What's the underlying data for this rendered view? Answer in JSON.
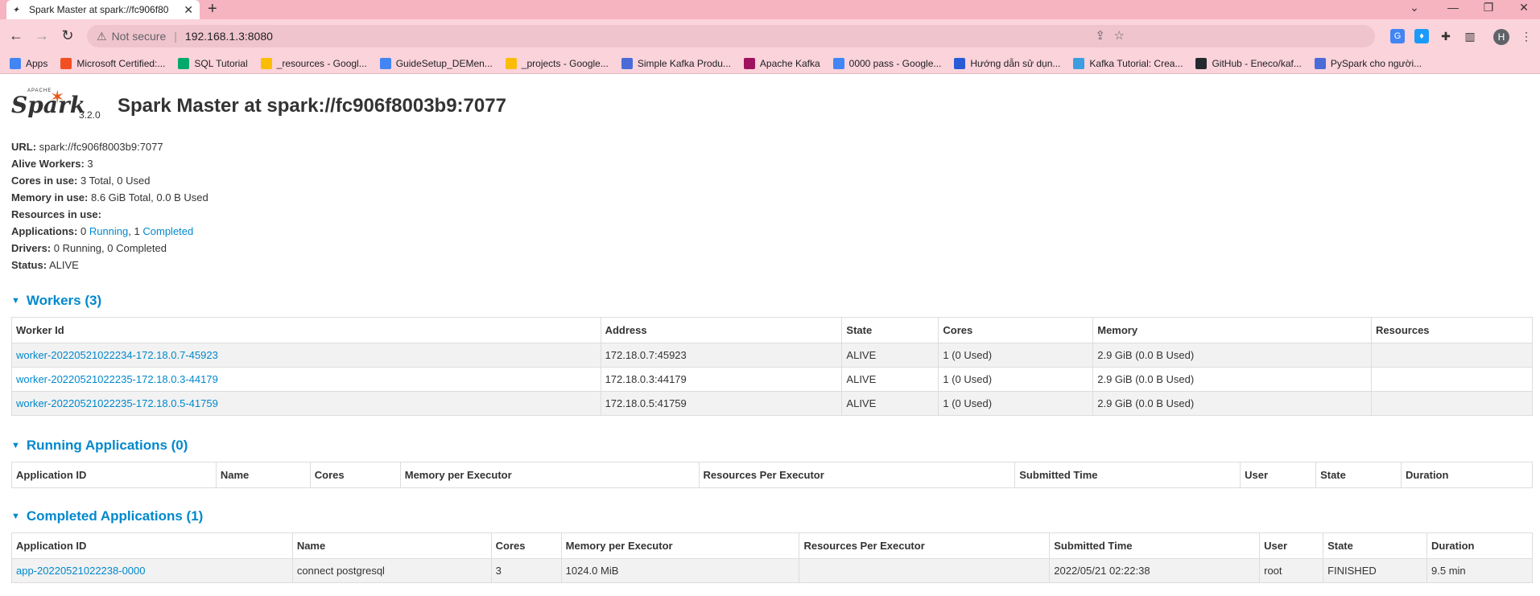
{
  "browser": {
    "tab_title": "Spark Master at spark://fc906f80",
    "tab_favicon": "spark",
    "url_warning": "Not secure",
    "url": "192.168.1.3:8080",
    "profile_initial": "H",
    "bookmarks": [
      {
        "label": "Apps",
        "icon": "apps-grid-icon",
        "color": "#4285f4"
      },
      {
        "label": "Microsoft Certified:...",
        "icon": "microsoft-icon",
        "color": "#f25022"
      },
      {
        "label": "SQL Tutorial",
        "icon": "w3-icon",
        "color": "#04aa6d"
      },
      {
        "label": "_resources - Googl...",
        "icon": "google-drive-icon",
        "color": "#fbbc04"
      },
      {
        "label": "GuideSetup_DEMen...",
        "icon": "google-docs-icon",
        "color": "#4285f4"
      },
      {
        "label": "_projects - Google...",
        "icon": "google-drive-icon",
        "color": "#fbbc04"
      },
      {
        "label": "Simple Kafka Produ...",
        "icon": "v-icon",
        "color": "#4a6bd8"
      },
      {
        "label": "Apache Kafka",
        "icon": "feather-icon",
        "color": "#a0115f"
      },
      {
        "label": "0000 pass - Google...",
        "icon": "google-docs-icon",
        "color": "#4285f4"
      },
      {
        "label": "Hướng dẫn sử dụn...",
        "icon": "d-icon",
        "color": "#2a5bd7"
      },
      {
        "label": "Kafka Tutorial: Crea...",
        "icon": "triangle-icon",
        "color": "#3c9de1"
      },
      {
        "label": "GitHub - Eneco/kaf...",
        "icon": "github-icon",
        "color": "#24292e"
      },
      {
        "label": "PySpark cho người...",
        "icon": "v-icon",
        "color": "#4a6bd8"
      }
    ]
  },
  "header": {
    "logo_apache": "APACHE",
    "logo_spark": "Spark",
    "version": "3.2.0",
    "title": "Spark Master at spark://fc906f8003b9:7077"
  },
  "summary": {
    "url_label": "URL:",
    "url_value": "spark://fc906f8003b9:7077",
    "alive_label": "Alive Workers:",
    "alive_value": "3",
    "cores_label": "Cores in use:",
    "cores_value": "3 Total, 0 Used",
    "memory_label": "Memory in use:",
    "memory_value": "8.6 GiB Total, 0.0 B Used",
    "resources_label": "Resources in use:",
    "apps_label": "Applications:",
    "apps_running_count": "0",
    "apps_running_link": "Running",
    "apps_sep": ",",
    "apps_completed_count": "1",
    "apps_completed_link": "Completed",
    "drivers_label": "Drivers:",
    "drivers_value": "0 Running, 0 Completed",
    "status_label": "Status:",
    "status_value": "ALIVE"
  },
  "workers": {
    "title": "Workers (3)",
    "columns": [
      "Worker Id",
      "Address",
      "State",
      "Cores",
      "Memory",
      "Resources"
    ],
    "rows": [
      [
        "worker-20220521022234-172.18.0.7-45923",
        "172.18.0.7:45923",
        "ALIVE",
        "1 (0 Used)",
        "2.9 GiB (0.0 B Used)",
        ""
      ],
      [
        "worker-20220521022235-172.18.0.3-44179",
        "172.18.0.3:44179",
        "ALIVE",
        "1 (0 Used)",
        "2.9 GiB (0.0 B Used)",
        ""
      ],
      [
        "worker-20220521022235-172.18.0.5-41759",
        "172.18.0.5:41759",
        "ALIVE",
        "1 (0 Used)",
        "2.9 GiB (0.0 B Used)",
        ""
      ]
    ]
  },
  "running": {
    "title": "Running Applications (0)",
    "columns": [
      "Application ID",
      "Name",
      "Cores",
      "Memory per Executor",
      "Resources Per Executor",
      "Submitted Time",
      "User",
      "State",
      "Duration"
    ]
  },
  "completed": {
    "title": "Completed Applications (1)",
    "columns": [
      "Application ID",
      "Name",
      "Cores",
      "Memory per Executor",
      "Resources Per Executor",
      "Submitted Time",
      "User",
      "State",
      "Duration"
    ],
    "rows": [
      [
        "app-20220521022238-0000",
        "connect postgresql",
        "3",
        "1024.0 MiB",
        "",
        "2022/05/21 02:22:38",
        "root",
        "FINISHED",
        "9.5 min"
      ]
    ]
  },
  "colors": {
    "link": "#0088cc",
    "tabbar": "#f6b3c0",
    "toolbar": "#fbd3db",
    "spark_orange": "#e25a1c"
  }
}
